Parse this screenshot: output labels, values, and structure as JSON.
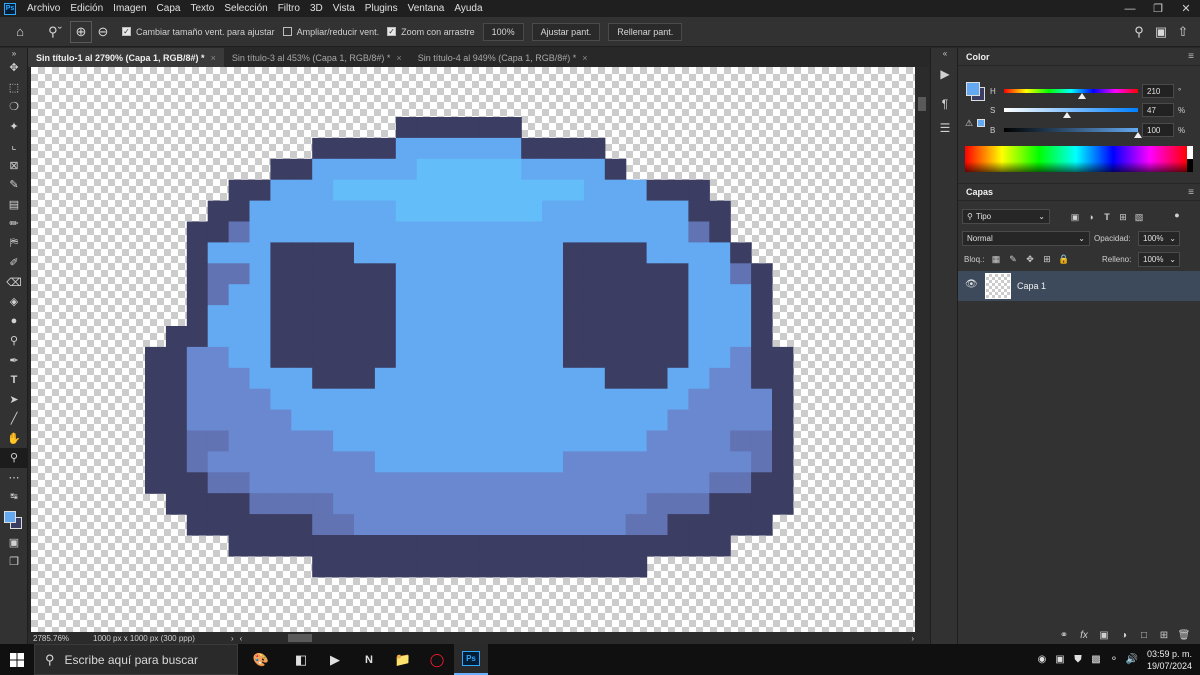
{
  "app": {
    "logo_text": "Ps"
  },
  "menu": [
    "Archivo",
    "Edición",
    "Imagen",
    "Capa",
    "Texto",
    "Selección",
    "Filtro",
    "3D",
    "Vista",
    "Plugins",
    "Ventana",
    "Ayuda"
  ],
  "options": {
    "resize_windows_label": "Cambiar tamaño vent. para ajustar",
    "resize_windows_checked": true,
    "zoom_all_label": "Ampliar/reducir vent.",
    "zoom_all_checked": false,
    "scrubby_zoom_label": "Zoom con arrastre",
    "scrubby_zoom_checked": true,
    "zoom_percent": "100%",
    "fit_screen_label": "Ajustar pant.",
    "fill_screen_label": "Rellenar pant."
  },
  "tabs": [
    {
      "label": "Sin título-1 al 2790% (Capa 1, RGB/8#) *",
      "active": true
    },
    {
      "label": "Sin título-3 al 453% (Capa 1, RGB/8#) *",
      "active": false
    },
    {
      "label": "Sin título-4 al 949% (Capa 1, RGB/8#) *",
      "active": false
    }
  ],
  "status": {
    "zoom": "2785.76%",
    "doc_size": "1000 px x 1000 px (300 ppp)"
  },
  "colors": {
    "outline": "#3b3d63",
    "body": "#64aaf2",
    "highlight": "#63bdf8",
    "shade": "#6988cf",
    "mid_shade": "#6173b3",
    "foreground": "#64aaf2",
    "background": "#3b3d63"
  },
  "color_panel": {
    "title": "Color",
    "h_label": "H",
    "h_value": "210",
    "h_unit": "°",
    "h_fraction": 0.583,
    "s_label": "S",
    "s_value": "47",
    "s_unit": "%",
    "s_fraction": 0.47,
    "b_label": "B",
    "b_value": "100",
    "b_unit": "%",
    "b_fraction": 1.0
  },
  "layers_panel": {
    "title": "Capas",
    "filter_label": "Tipo",
    "blend_mode": "Normal",
    "opacity_label": "Opacidad:",
    "opacity_value": "100%",
    "lock_label": "Bloq.:",
    "fill_label": "Relleno:",
    "fill_value": "100%",
    "layers": [
      {
        "name": "Capa 1",
        "visible": true,
        "selected": true
      }
    ]
  },
  "taskbar": {
    "search_placeholder": "Escribe aquí para buscar",
    "time": "03:59 p. m.",
    "date": "19/07/2024"
  },
  "pixel_art": {
    "grid_cols": 30,
    "grid_rows": 23,
    "rows": [
      "............000000............",
      "........00001111110000........",
      "......00111112222211110.......",
      "....00111222222222222111000...",
      "...0011111112222222111111100..",
      "..00311111111111111111111130..",
      "..011100001111111111000011110.",
      "..0331000000111111110000001130",
      "..0311000000111111110000001110",
      "..0111000000111111110000001110",
      ".00111000000111111110000001110",
      "0044110000001111111100000011400",
      "0044411100011111111111000114400",
      "0044441111111111111111111144440",
      "0044444111111111111111111444440",
      "0035444441111111111111114444530",
      "0054444444411111111144444444450",
      "0005544444444444444444444445500",
      ".000055554444444444444445550000",
      "..0000005544444444444445500000.",
      "....000000000000000000000000...",
      "........0000000000000000.......",
      "..............................."
    ]
  }
}
